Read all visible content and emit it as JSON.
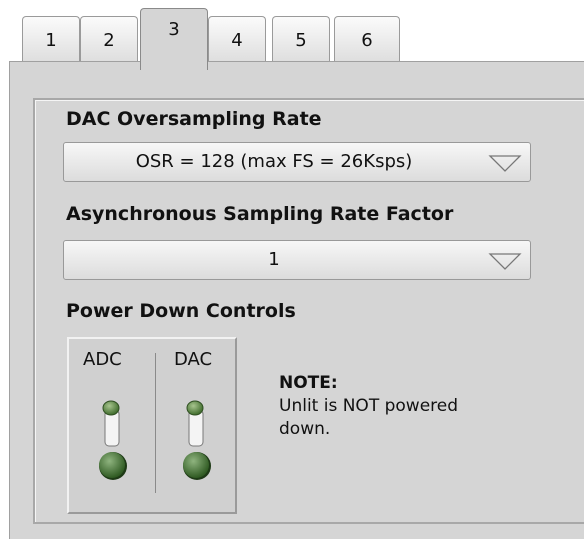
{
  "tabs": [
    "1",
    "2",
    "3",
    "4",
    "5",
    "6"
  ],
  "active_tab": "3",
  "dac_oversampling": {
    "label": "DAC Oversampling Rate",
    "value": "OSR = 128 (max FS = 26Ksps)"
  },
  "async_rate": {
    "label": "Asynchronous Sampling Rate Factor",
    "value": "1"
  },
  "power_down": {
    "label": "Power Down Controls",
    "adc_label": "ADC",
    "dac_label": "DAC"
  },
  "note": {
    "title": "NOTE:",
    "text": "Unlit is NOT powered down."
  }
}
